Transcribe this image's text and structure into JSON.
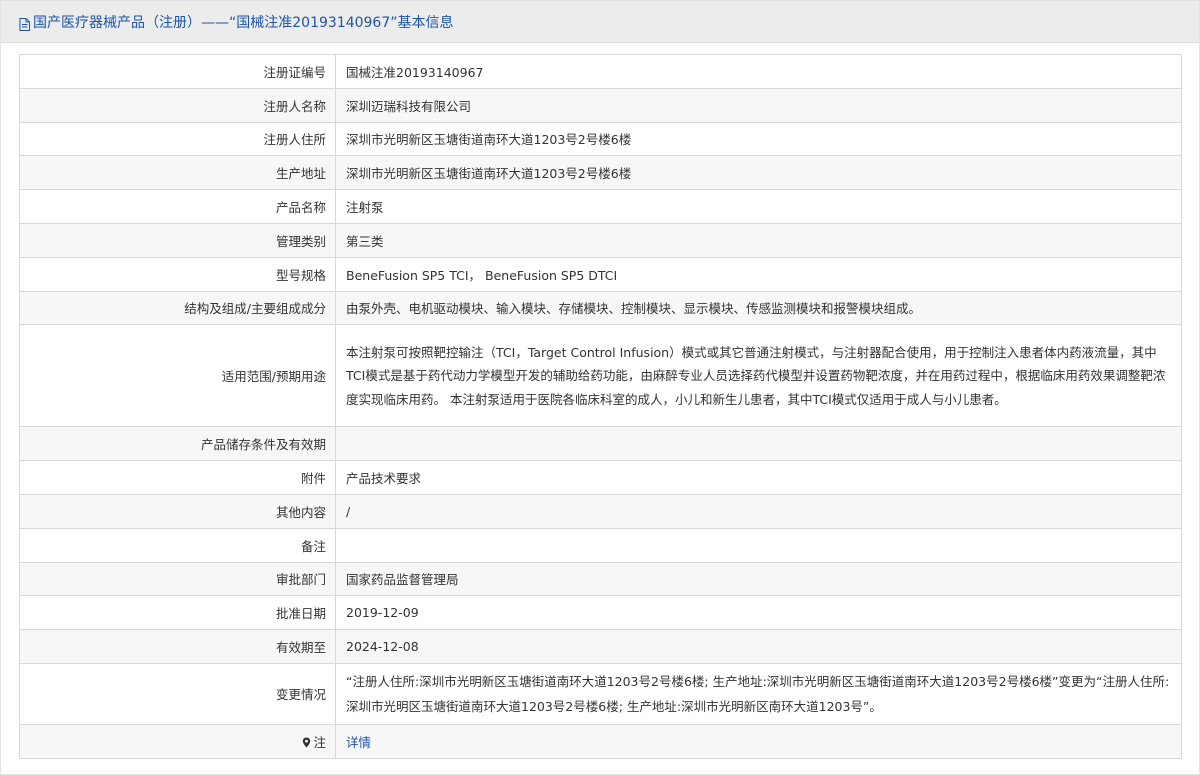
{
  "header": {
    "title": "国产医疗器械产品（注册）——“国械注准20193140967”基本信息"
  },
  "rows": [
    {
      "label": "注册证编号",
      "value": "国械注准20193140967"
    },
    {
      "label": "注册人名称",
      "value": "深圳迈瑞科技有限公司"
    },
    {
      "label": "注册人住所",
      "value": "深圳市光明新区玉塘街道南环大道1203号2号楼6楼"
    },
    {
      "label": "生产地址",
      "value": "深圳市光明新区玉塘街道南环大道1203号2号楼6楼"
    },
    {
      "label": "产品名称",
      "value": "注射泵"
    },
    {
      "label": "管理类别",
      "value": "第三类"
    },
    {
      "label": "型号规格",
      "value": "BeneFusion SP5 TCI， BeneFusion SP5 DTCI"
    },
    {
      "label": "结构及组成/主要组成成分",
      "value": "由泵外壳、电机驱动模块、输入模块、存储模块、控制模块、显示模块、传感监测模块和报警模块组成。"
    },
    {
      "label": "适用范围/预期用途",
      "value": "本注射泵可按照靶控输注（TCI，Target Control Infusion）模式或其它普通注射模式，与注射器配合使用，用于控制注入患者体内药液流量，其中TCI模式是基于药代动力学模型开发的辅助给药功能，由麻醉专业人员选择药代模型并设置药物靶浓度，并在用药过程中，根据临床用药效果调整靶浓度实现临床用药。 本注射泵适用于医院各临床科室的成人，小儿和新生儿患者，其中TCI模式仅适用于成人与小儿患者。"
    },
    {
      "label": "产品储存条件及有效期",
      "value": ""
    },
    {
      "label": "附件",
      "value": "产品技术要求"
    },
    {
      "label": "其他内容",
      "value": "/"
    },
    {
      "label": "备注",
      "value": ""
    },
    {
      "label": "审批部门",
      "value": "国家药品监督管理局"
    },
    {
      "label": "批准日期",
      "value": "2019-12-09"
    },
    {
      "label": "有效期至",
      "value": "2024-12-08"
    },
    {
      "label": "变更情况",
      "value": "“注册人住所:深圳市光明新区玉塘街道南环大道1203号2号楼6楼; 生产地址:深圳市光明新区玉塘街道南环大道1203号2号楼6楼”变更为“注册人住所:深圳市光明区玉塘街道南环大道1203号2号楼6楼; 生产地址:深圳市光明新区南环大道1203号”。"
    }
  ],
  "note": {
    "label": "注",
    "link_text": "详情"
  },
  "icons": {
    "header_icon": "document-icon",
    "note_icon": "pin-icon"
  },
  "colors": {
    "link": "#1e55a5",
    "header_bg": "#ececec",
    "row_alt_bg": "#f7f7f7",
    "border": "#d8d8d8"
  }
}
